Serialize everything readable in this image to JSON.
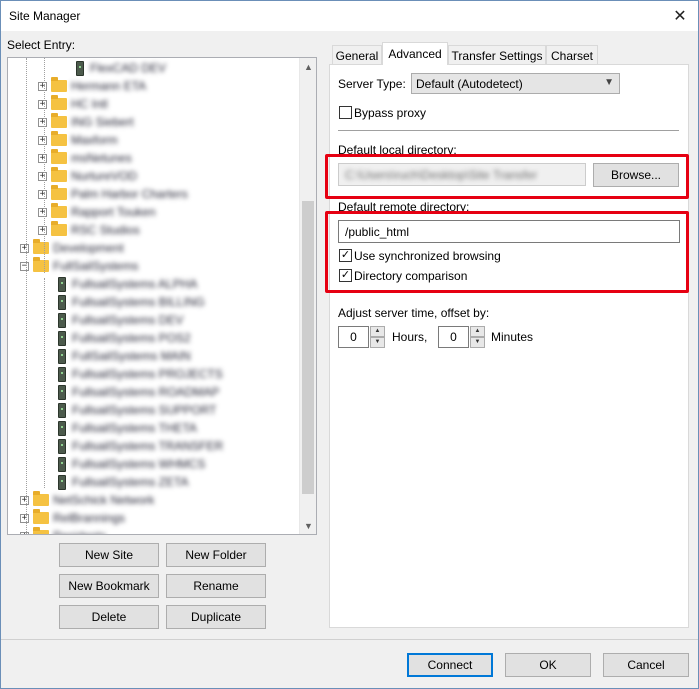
{
  "window": {
    "title": "Site Manager",
    "close_glyph": "✕"
  },
  "left": {
    "select_entry_label": "Select Entry:",
    "tree_items": [
      {
        "type": "server",
        "label": "FlexCAD DEV"
      },
      {
        "type": "folder",
        "label": "Hermann ETA"
      },
      {
        "type": "folder",
        "label": "HC Intl"
      },
      {
        "type": "folder",
        "label": "ING Siebert"
      },
      {
        "type": "folder",
        "label": "Maxform"
      },
      {
        "type": "folder",
        "label": "msNetunes"
      },
      {
        "type": "folder",
        "label": "NurtureVOD"
      },
      {
        "type": "folder",
        "label": "Palm Harbor Charters"
      },
      {
        "type": "folder",
        "label": "Rapport Touken"
      },
      {
        "type": "folder",
        "label": "RSC Studios"
      },
      {
        "type": "folder",
        "label": "Development"
      },
      {
        "type": "folder",
        "label": "FullSailSystems"
      },
      {
        "type": "server",
        "label": "FullsailSystems ALPHA"
      },
      {
        "type": "server",
        "label": "FullsailSystems BILLING"
      },
      {
        "type": "server",
        "label": "FullsailSystems DEV"
      },
      {
        "type": "server",
        "label": "FullsailSystems POS2"
      },
      {
        "type": "server",
        "label": "FullSailSystems MAIN"
      },
      {
        "type": "server",
        "label": "FullsailSystems PROJECTS"
      },
      {
        "type": "server",
        "label": "FullsailSystems ROADMAP"
      },
      {
        "type": "server",
        "label": "FullsailSystems SUPPORT"
      },
      {
        "type": "server",
        "label": "FullsailSystems THETA"
      },
      {
        "type": "server",
        "label": "FullsailSystems TRANSFER"
      },
      {
        "type": "server",
        "label": "FullsailSystems WHMCS"
      },
      {
        "type": "server",
        "label": "FullsailSystems ZETA"
      },
      {
        "type": "folder",
        "label": "NetSchick Network"
      },
      {
        "type": "folder",
        "label": "RelBrannings"
      },
      {
        "type": "folder",
        "label": "Residents"
      }
    ],
    "buttons": {
      "new_site": "New Site",
      "new_folder": "New Folder",
      "new_bookmark": "New Bookmark",
      "rename": "Rename",
      "delete": "Delete",
      "duplicate": "Duplicate"
    }
  },
  "tabs": [
    "General",
    "Advanced",
    "Transfer Settings",
    "Charset"
  ],
  "advanced": {
    "server_type_label": "Server Type:",
    "server_type_value": "Default (Autodetect)",
    "bypass_proxy_label": "Bypass proxy",
    "bypass_proxy_checked": false,
    "local_dir_label": "Default local directory:",
    "local_dir_value": "C:\\Users\\ruch\\Desktop\\Site Transfer",
    "browse_label": "Browse...",
    "remote_dir_label": "Default remote directory:",
    "remote_dir_value": "/public_html",
    "sync_browsing_label": "Use synchronized browsing",
    "sync_browsing_checked": true,
    "dir_comparison_label": "Directory comparison",
    "dir_comparison_checked": true,
    "adjust_time_label": "Adjust server time, offset by:",
    "hours_value": "0",
    "hours_label": "Hours,",
    "minutes_value": "0",
    "minutes_label": "Minutes",
    "check_glyph": "✓"
  },
  "footer": {
    "connect": "Connect",
    "ok": "OK",
    "cancel": "Cancel"
  },
  "colors": {
    "highlight": "#e60012",
    "accent": "#0078d7",
    "folder": "#f5c242"
  }
}
